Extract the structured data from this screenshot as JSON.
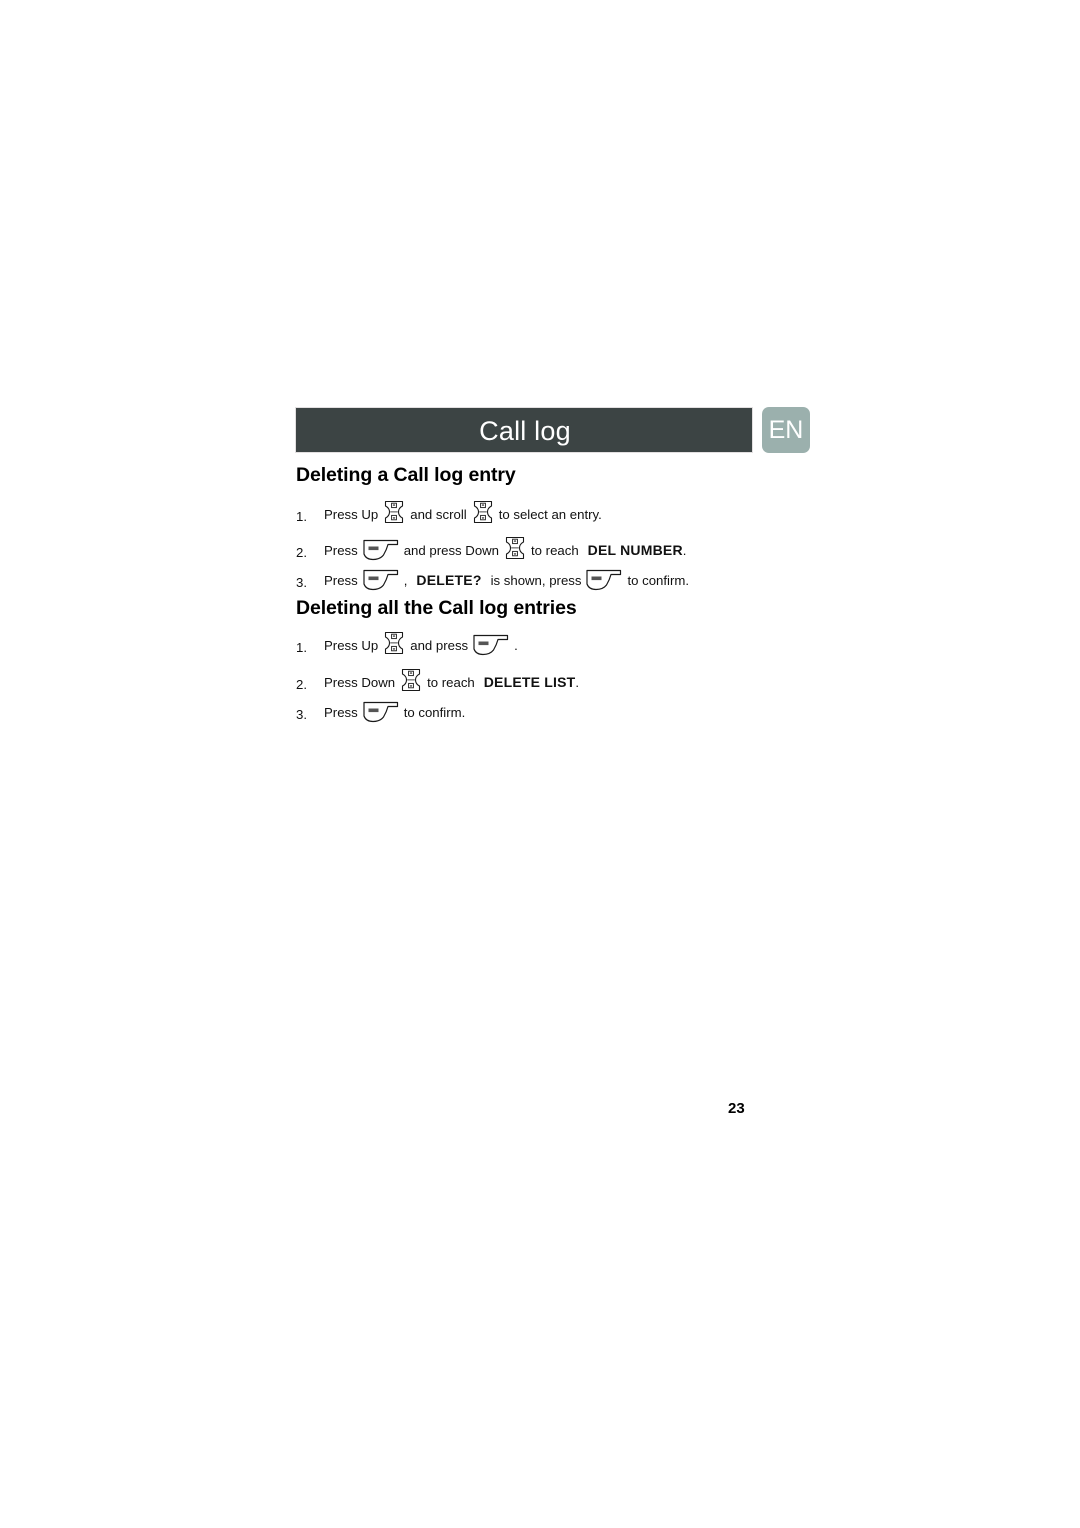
{
  "document": {
    "page_number": "23",
    "language_badge": "EN",
    "header_title": "Call log",
    "colors": {
      "header_bar": "#3c4444",
      "header_text": "#ffffff",
      "language_badge_bg": "#9bb0ad",
      "body_text": "#111111",
      "page_background": "#ffffff"
    }
  },
  "sections": [
    {
      "heading": "Deleting a Call log entry",
      "steps": [
        {
          "number": "1.",
          "parts": [
            {
              "type": "text",
              "value": "Press Up"
            },
            {
              "type": "icon",
              "name": "scroll-key-icon"
            },
            {
              "type": "text",
              "value": "and scroll"
            },
            {
              "type": "icon",
              "name": "scroll-key-icon"
            },
            {
              "type": "text",
              "value": "to select an entry."
            }
          ]
        },
        {
          "number": "2.",
          "parts": [
            {
              "type": "text",
              "value": "Press"
            },
            {
              "type": "icon",
              "name": "menu-key-icon"
            },
            {
              "type": "text",
              "value": "and press Down"
            },
            {
              "type": "icon",
              "name": "scroll-key-icon"
            },
            {
              "type": "text",
              "value": "to reach"
            },
            {
              "type": "bold",
              "value": "DEL NUMBER"
            },
            {
              "type": "text",
              "value": "."
            }
          ]
        },
        {
          "number": "3.",
          "parts": [
            {
              "type": "text",
              "value": "Press"
            },
            {
              "type": "icon",
              "name": "menu-key-icon"
            },
            {
              "type": "text",
              "value": ","
            },
            {
              "type": "bold",
              "value": "DELETE?"
            },
            {
              "type": "text",
              "value": "is shown, press"
            },
            {
              "type": "icon",
              "name": "menu-key-icon"
            },
            {
              "type": "text",
              "value": "to confirm."
            }
          ]
        }
      ]
    },
    {
      "heading": "Deleting all the Call log entries",
      "steps": [
        {
          "number": "1.",
          "parts": [
            {
              "type": "text",
              "value": "Press Up"
            },
            {
              "type": "icon",
              "name": "scroll-key-icon"
            },
            {
              "type": "text",
              "value": "and press"
            },
            {
              "type": "icon",
              "name": "menu-key-icon"
            },
            {
              "type": "text",
              "value": "."
            }
          ]
        },
        {
          "number": "2.",
          "parts": [
            {
              "type": "text",
              "value": "Press Down"
            },
            {
              "type": "icon",
              "name": "scroll-key-icon"
            },
            {
              "type": "text",
              "value": "to reach"
            },
            {
              "type": "bold",
              "value": "DELETE LIST"
            },
            {
              "type": "text",
              "value": "."
            }
          ]
        },
        {
          "number": "3.",
          "parts": [
            {
              "type": "text",
              "value": "Press"
            },
            {
              "type": "icon",
              "name": "menu-key-icon"
            },
            {
              "type": "text",
              "value": "to confirm."
            }
          ]
        }
      ]
    }
  ]
}
